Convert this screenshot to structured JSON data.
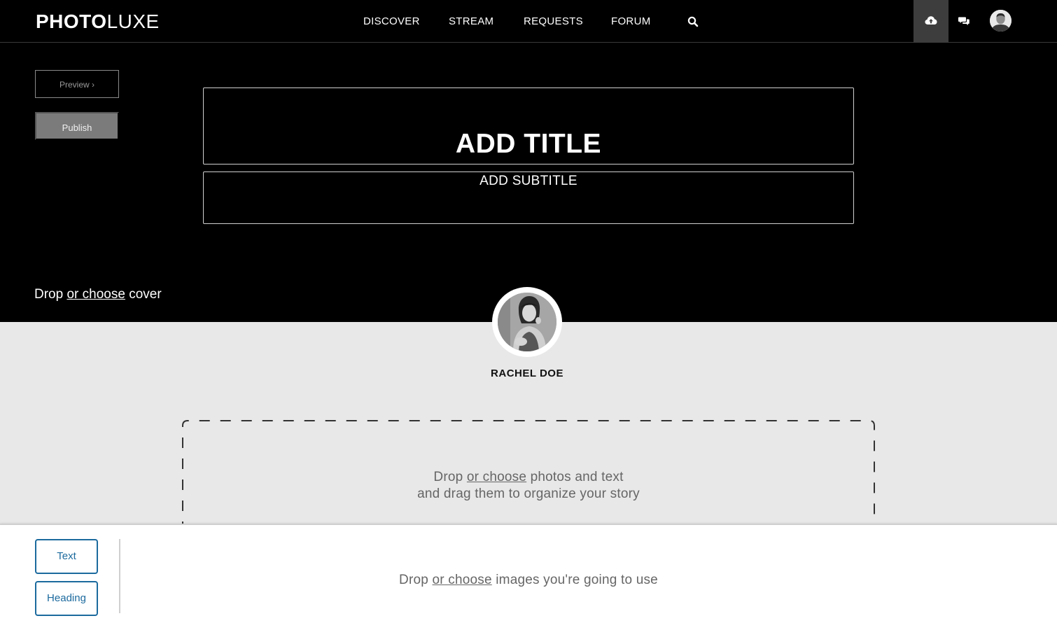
{
  "header": {
    "logo_bold": "PHOTO",
    "logo_light": "LUXE",
    "nav": [
      "DISCOVER",
      "STREAM",
      "REQUESTS",
      "FORUM"
    ],
    "icons": [
      "search-icon",
      "cloud-upload-icon",
      "chat-icon",
      "user-avatar"
    ]
  },
  "editor": {
    "preview_label": "Preview",
    "preview_chevron": "›",
    "publish_label": "Publish",
    "title_placeholder": "ADD TITLE",
    "subtitle_placeholder": "ADD SUBTITLE",
    "cover_drop": {
      "prefix": "Drop",
      "link": "or choose",
      "suffix": "cover"
    }
  },
  "author": {
    "name": "RACHEL DOE"
  },
  "story_drop": {
    "line1_prefix": "Drop",
    "line1_link": "or choose",
    "line1_suffix": "photos and text",
    "line2": "and drag them to organize your story"
  },
  "bottom_bar": {
    "text_button": "Text",
    "heading_button": "Heading",
    "images_drop": {
      "prefix": "Drop",
      "link": "or choose",
      "suffix": "images you're going to use"
    }
  },
  "colors": {
    "accent": "#1c6a9e",
    "navbar_bg": "#000000",
    "cover_bg": "#000000",
    "page_bg": "#e8e8e8",
    "publish_bg": "#7b7b7b",
    "upload_tab_bg": "#3d3d3d"
  }
}
